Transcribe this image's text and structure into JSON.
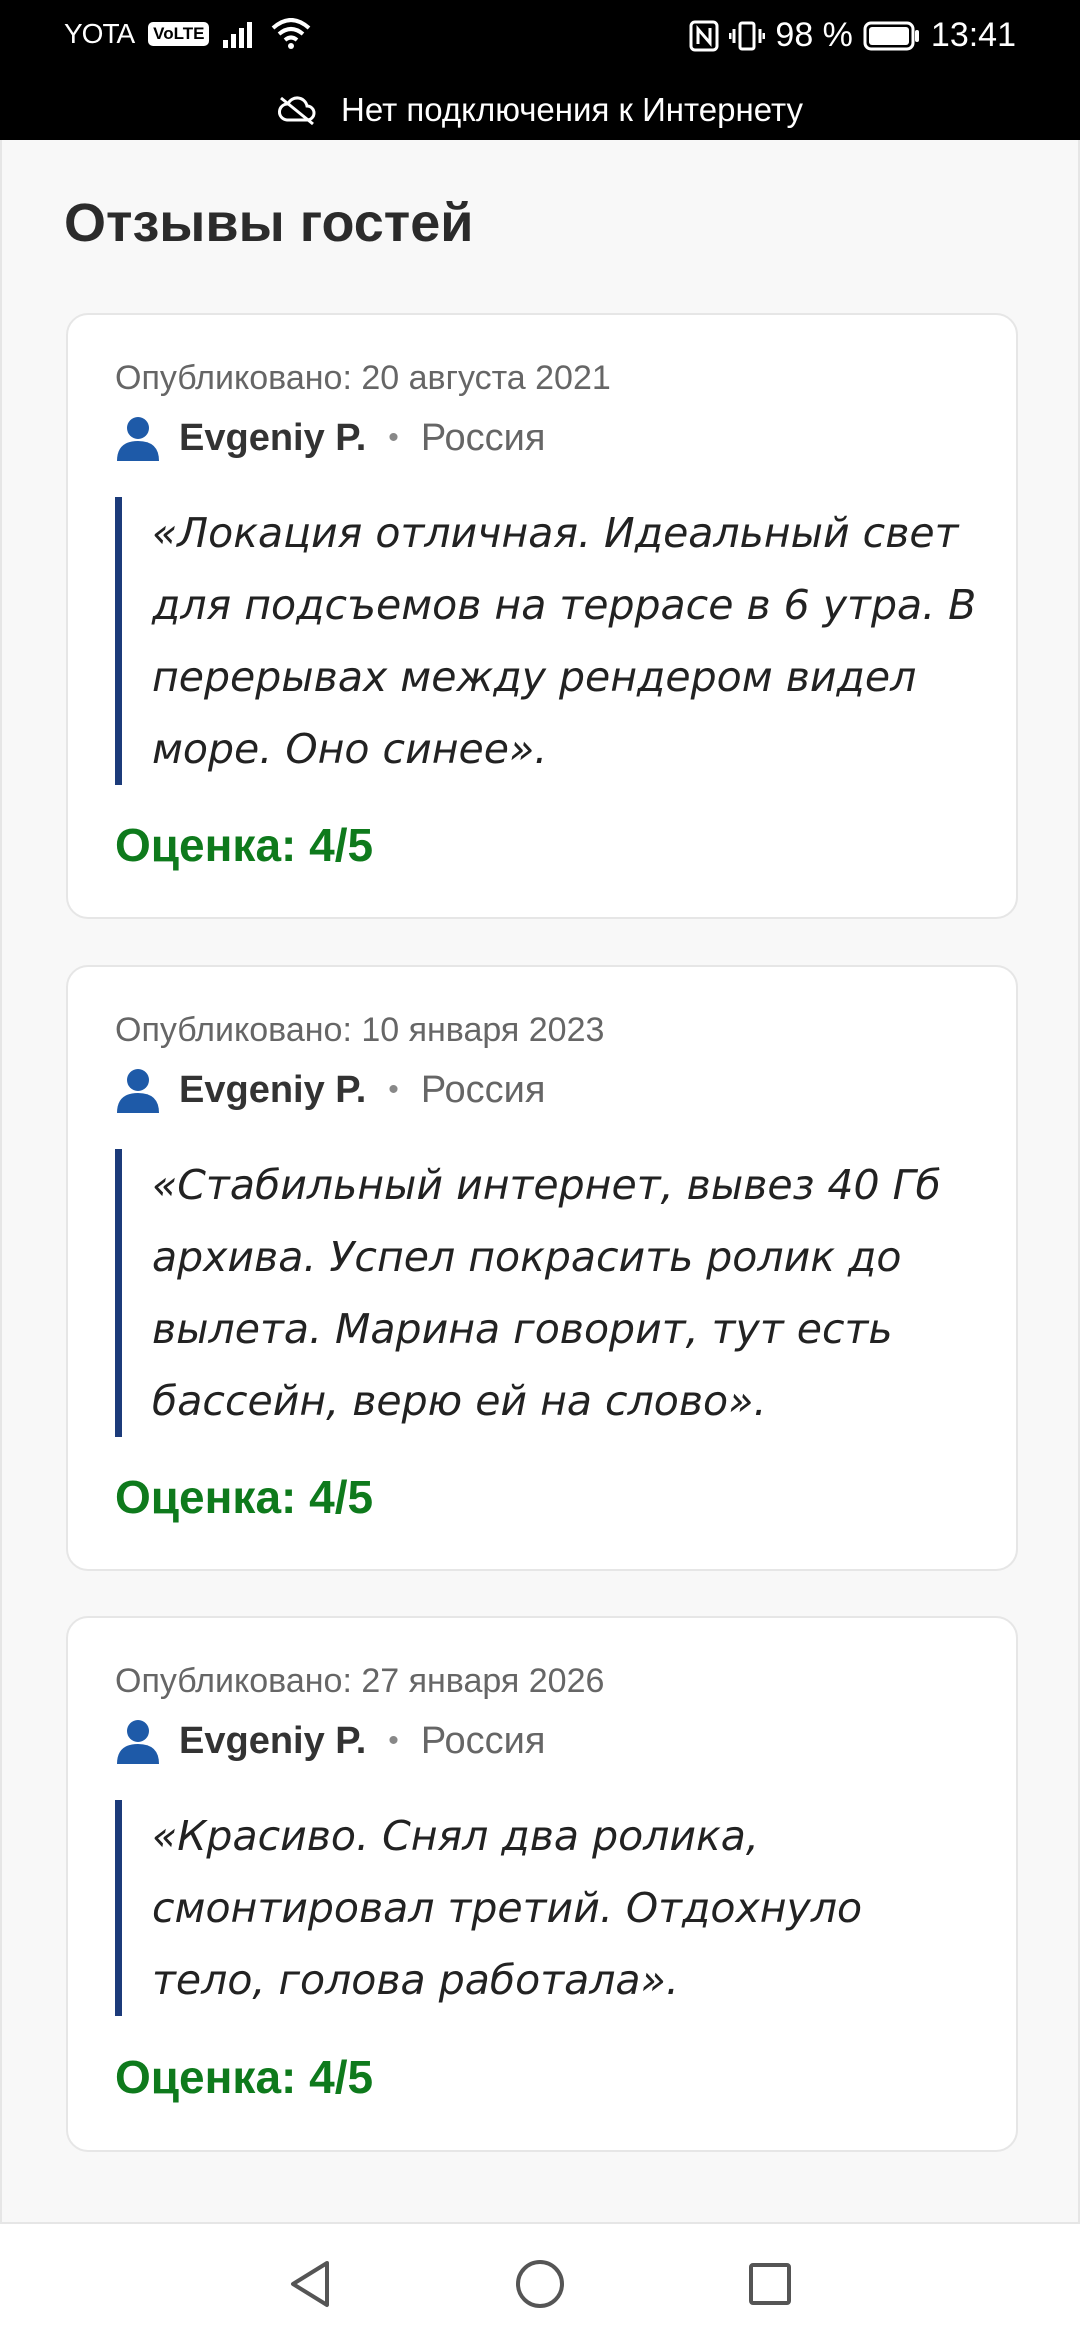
{
  "status_bar": {
    "carrier": "YOTA",
    "volte": "VoLTE",
    "battery": "98 %",
    "time": "13:41",
    "offline_message": "Нет подключения к Интернету"
  },
  "page": {
    "title": "Отзывы гостей"
  },
  "reviews": [
    {
      "published": "Опубликовано: 20 августа 2021",
      "author": "Evgeniy P.",
      "separator": "•",
      "country": "Россия",
      "text": "«Локация отличная. Идеальный свет для подсъемов на террасе в 6 утра. В перерывах между рендером видел море. Оно синее».",
      "rating": "Оценка: 4/5"
    },
    {
      "published": "Опубликовано: 10 января 2023",
      "author": "Evgeniy P.",
      "separator": "•",
      "country": "Россия",
      "text": "«Стабильный интернет, вывез 40 Гб архива. Успел покрасить ролик до вылета. Марина говорит, тут есть бассейн, верю ей на слово».",
      "rating": "Оценка: 4/5"
    },
    {
      "published": "Опубликовано: 27 января 2026",
      "author": "Evgeniy P.",
      "separator": "•",
      "country": "Россия",
      "text": "«Красиво. Снял два ролика, смонтировал третий. Отдохнуло тело, голова работала».",
      "rating": "Оценка: 4/5"
    }
  ],
  "colors": {
    "quote_border": "#1c3b7a",
    "rating": "#0e7a1c",
    "person_icon": "#1e5aa8"
  },
  "icons": {
    "person": "person-icon",
    "no_cloud": "cloud-off-icon",
    "back": "back-triangle-icon",
    "home": "home-circle-icon",
    "recent": "recent-square-icon"
  }
}
